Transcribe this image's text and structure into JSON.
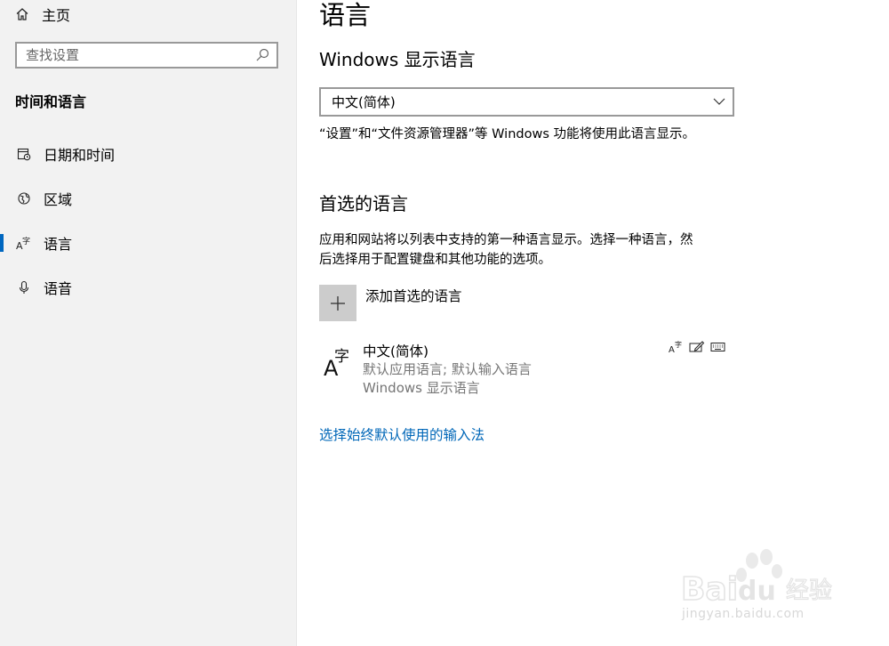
{
  "sidebar": {
    "home_label": "主页",
    "search_placeholder": "查找设置",
    "section_title": "时间和语言",
    "items": [
      {
        "label": "日期和时间",
        "icon": "calendar-clock-icon"
      },
      {
        "label": "区域",
        "icon": "globe-icon"
      },
      {
        "label": "语言",
        "icon": "language-icon",
        "selected": true
      },
      {
        "label": "语音",
        "icon": "microphone-icon"
      }
    ],
    "accent_color": "#0067c0"
  },
  "main": {
    "page_title": "语言",
    "display_language": {
      "heading": "Windows 显示语言",
      "selected": "中文(简体)",
      "description": "“设置”和“文件资源管理器”等 Windows 功能将使用此语言显示。"
    },
    "preferred": {
      "heading": "首选的语言",
      "description_line1": "应用和网站将以列表中支持的第一种语言显示。选择一种语言，然",
      "description_line2": "后选择用于配置键盘和其他功能的选项。",
      "add_label": "添加首选的语言",
      "languages": [
        {
          "name": "中文(简体)",
          "detail1": "默认应用语言; 默认输入语言",
          "detail2": "Windows 显示语言",
          "features": [
            "display-language-icon",
            "handwriting-icon",
            "keyboard-icon"
          ]
        }
      ]
    },
    "input_method_link": "选择始终默认使用的输入法",
    "link_color": "#0067b8"
  },
  "watermark": {
    "logo_text": "Baidu经验",
    "url_text": "jingyan.baidu.com"
  }
}
